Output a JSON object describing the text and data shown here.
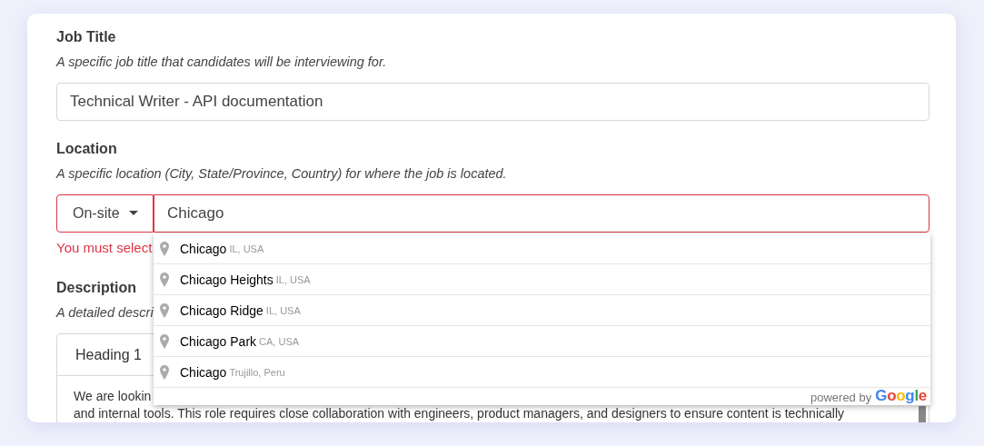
{
  "fields": [
    {
      "kind": "text",
      "label": "Job Title",
      "hint": "A specific job title that candidates will be interviewing for.",
      "value": "Technical Writer - API documentation"
    },
    {
      "kind": "location",
      "label": "Location",
      "hint": "A specific location (City, State/Province, Country) for where the job is located.",
      "mode": "On-site",
      "value": "Chicago",
      "invalid": true,
      "error": "You must select"
    },
    {
      "kind": "editor",
      "label": "Description",
      "hint": "A detailed descri",
      "format": "Heading 1",
      "lines": [
        "We are lookin",
        "and internal tools. This role requires close collaboration with engineers, product managers, and designers to ensure content is technically"
      ]
    }
  ],
  "suggestions": [
    {
      "name": "Chicago",
      "region": "IL, USA"
    },
    {
      "name": "Chicago Heights",
      "region": "IL, USA"
    },
    {
      "name": "Chicago Ridge",
      "region": "IL, USA"
    },
    {
      "name": "Chicago Park",
      "region": "CA, USA"
    },
    {
      "name": "Chicago",
      "region": "Trujillo, Peru"
    }
  ],
  "attribution": {
    "prefix": "powered by",
    "brand": "Google"
  }
}
